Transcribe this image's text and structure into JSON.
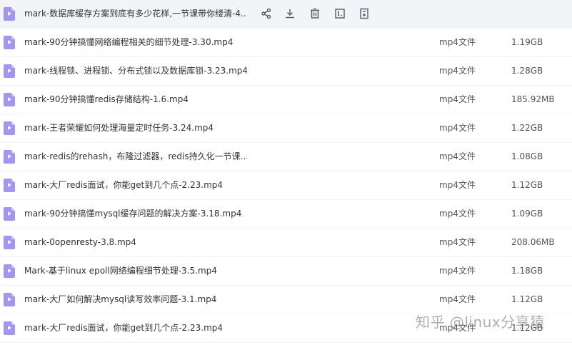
{
  "files": [
    {
      "name": "mark-数据库缓存方案到底有多少花样,一节课带你缕清-4...",
      "type": "",
      "size": ""
    },
    {
      "name": "mark-90分钟搞懂网络编程相关的细节处理-3.30.mp4",
      "type": "mp4文件",
      "size": "1.19GB"
    },
    {
      "name": "mark-线程锁、进程锁、分布式锁以及数据库锁-3.23.mp4",
      "type": "mp4文件",
      "size": "1.28GB"
    },
    {
      "name": "mark-90分钟搞懂redis存储结构-1.6.mp4",
      "type": "mp4文件",
      "size": "185.92MB"
    },
    {
      "name": "mark-王者荣耀如何处理海量定时任务-3.24.mp4",
      "type": "mp4文件",
      "size": "1.22GB"
    },
    {
      "name": "mark-redis的rehash，布隆过滤器，redis持久化一节课...",
      "type": "mp4文件",
      "size": "1.08GB"
    },
    {
      "name": "mark-大厂redis面试，你能get到几个点-2.23.mp4",
      "type": "mp4文件",
      "size": "1.12GB"
    },
    {
      "name": "mark-90分钟搞懂mysql缓存问题的解决方案-3.18.mp4",
      "type": "mp4文件",
      "size": "1.09GB"
    },
    {
      "name": "mark-0openresty-3.8.mp4",
      "type": "mp4文件",
      "size": "208.06MB"
    },
    {
      "name": "Mark-基于linux epoll网络编程细节处理-3.5.mp4",
      "type": "mp4文件",
      "size": "1.18GB"
    },
    {
      "name": "mark-大厂如何解决mysql读写效率问题-3.1.mp4",
      "type": "mp4文件",
      "size": "1.12GB"
    },
    {
      "name": "mark-大厂redis面试，你能get到几个点-2.23.mp4",
      "type": "mp4文件",
      "size": "1.12GB"
    }
  ],
  "hover_actions": [
    "share-icon",
    "download-icon",
    "delete-icon",
    "rename-icon",
    "more-icon"
  ],
  "watermark": "知乎 @linux分享猿",
  "colors": {
    "file_icon": "#a196f4",
    "hover_row": "#f3f4f8",
    "action_icon": "#555a66"
  }
}
